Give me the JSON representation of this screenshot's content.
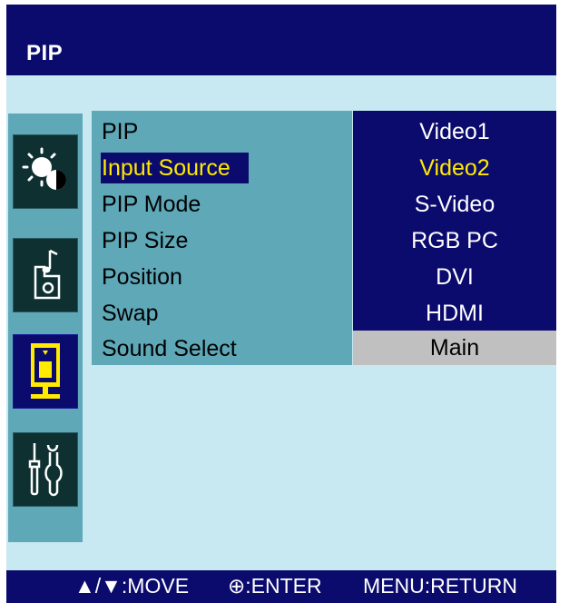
{
  "header": {
    "title": "PIP"
  },
  "sidebar": {
    "icons": [
      {
        "name": "brightness-contrast-icon"
      },
      {
        "name": "sound-icon"
      },
      {
        "name": "pip-icon",
        "active": true
      },
      {
        "name": "setup-tools-icon"
      }
    ]
  },
  "menu": {
    "items": [
      {
        "label": "PIP"
      },
      {
        "label": "Input Source",
        "selected": true
      },
      {
        "label": "PIP Mode"
      },
      {
        "label": "PIP Size"
      },
      {
        "label": "Position"
      },
      {
        "label": "Swap"
      },
      {
        "label": "Sound Select"
      }
    ]
  },
  "submenu": {
    "options": [
      {
        "label": "Video1"
      },
      {
        "label": "Video2",
        "selected": true
      },
      {
        "label": "S-Video"
      },
      {
        "label": "RGB PC"
      },
      {
        "label": "DVI"
      },
      {
        "label": "HDMI"
      }
    ],
    "sound_select_value": "Main"
  },
  "footer": {
    "move": "▲/▼:MOVE",
    "enter": "⊕:ENTER",
    "return": "MENU:RETURN"
  },
  "colors": {
    "header_bg": "#0b0b6e",
    "body_bg": "#c8e8f2",
    "menu_bg": "#5ea8b8",
    "highlight_text": "#ffea00",
    "value_bg": "#c0c0c0"
  }
}
